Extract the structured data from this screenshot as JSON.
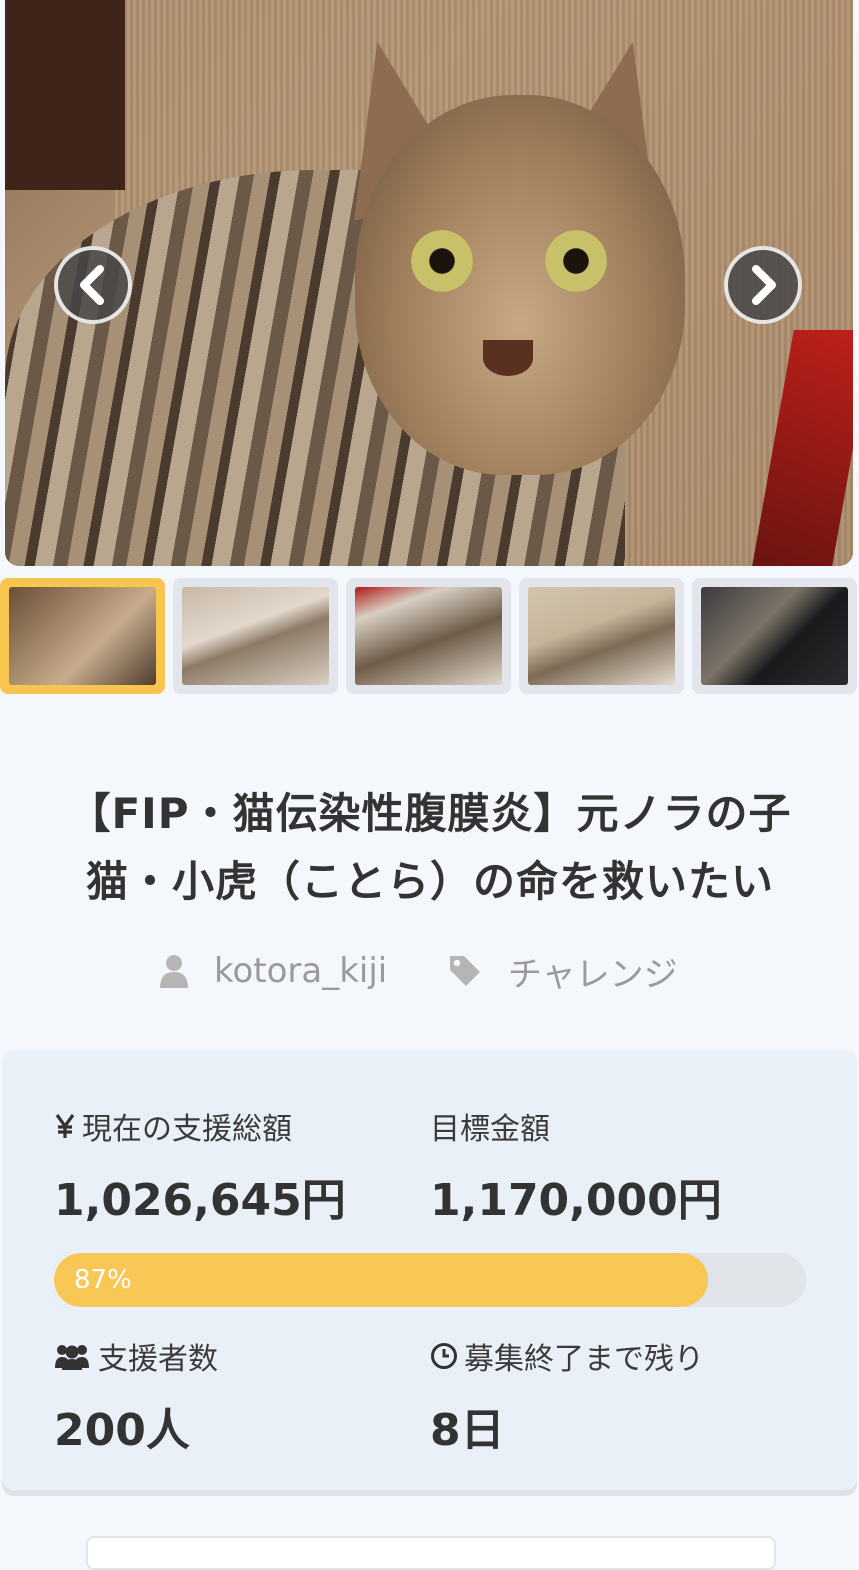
{
  "gallery": {
    "prev_icon": "chevron-left-icon",
    "next_icon": "chevron-right-icon",
    "thumbnail_count": 5,
    "active_index": 0,
    "accent_color": "#f8c54f"
  },
  "project": {
    "title": "【FIP・猫伝染性腹膜炎】元ノラの子猫・小虎（ことら）の命を救いたい",
    "author": "kotora_kiji",
    "category": "チャレンジ"
  },
  "stats": {
    "current_label": "現在の支援総額",
    "current_value": "1,026,645円",
    "goal_label": "目標金額",
    "goal_value": "1,170,000円",
    "progress_percent": 87,
    "progress_text": "87%",
    "supporters_label": "支援者数",
    "supporters_value": "200人",
    "remaining_label": "募集終了まで残り",
    "remaining_value": "8日",
    "progress_color": "#f8c755"
  }
}
